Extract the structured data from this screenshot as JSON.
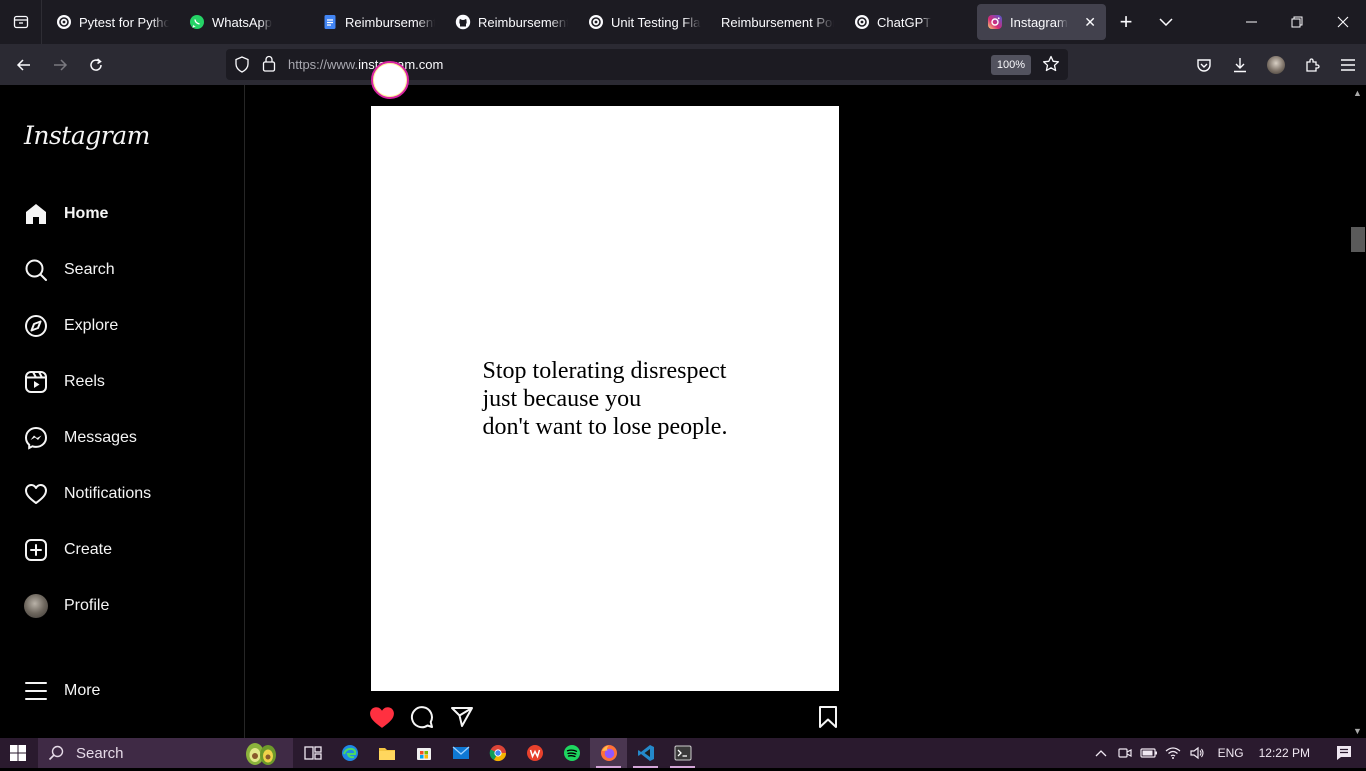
{
  "browser": {
    "tabs": [
      {
        "title": "Pytest for Python",
        "icon": "chatgpt-icon"
      },
      {
        "title": "WhatsApp",
        "icon": "whatsapp-icon"
      },
      {
        "title": "Reimbursement P",
        "icon": "google-docs-icon"
      },
      {
        "title": "Reimbursement-P",
        "icon": "github-icon"
      },
      {
        "title": "Unit Testing Flask",
        "icon": "chatgpt-icon"
      },
      {
        "title": "Reimbursement Porta",
        "icon": ""
      },
      {
        "title": "ChatGPT",
        "icon": "chatgpt-icon"
      },
      {
        "title": "Instagram",
        "icon": "instagram-icon",
        "active": true
      }
    ],
    "url_prefix": "https://www.",
    "url_host": "instagram.com",
    "zoom": "100%"
  },
  "instagram": {
    "logo": "Instagram",
    "nav": [
      {
        "label": "Home",
        "icon": "home-icon"
      },
      {
        "label": "Search",
        "icon": "search-icon"
      },
      {
        "label": "Explore",
        "icon": "compass-icon"
      },
      {
        "label": "Reels",
        "icon": "reels-icon"
      },
      {
        "label": "Messages",
        "icon": "messenger-icon"
      },
      {
        "label": "Notifications",
        "icon": "heart-icon"
      },
      {
        "label": "Create",
        "icon": "plus-square-icon"
      },
      {
        "label": "Profile",
        "icon": "avatar"
      }
    ],
    "more_label": "More",
    "post": {
      "quote_lines": [
        "Stop tolerating disrespect",
        "just because you",
        "don't want to lose people."
      ],
      "liked": true
    }
  },
  "taskbar": {
    "search_label": "Search",
    "language": "ENG",
    "time": "12:22 PM"
  },
  "colors": {
    "like_red": "#ff3040",
    "tab_active_bg": "#42414d",
    "taskbar_bg": "#2a1a2e"
  }
}
